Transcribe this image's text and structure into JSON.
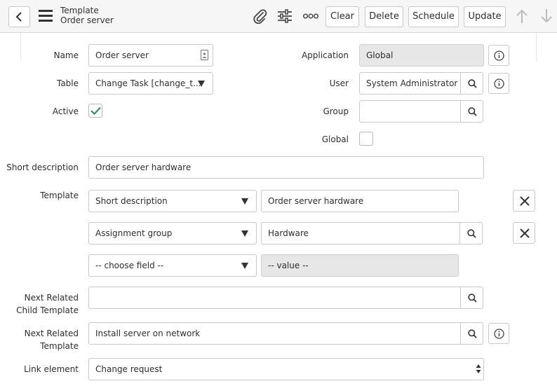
{
  "header": {
    "title": "Template",
    "subtitle": "Order server",
    "buttons": {
      "clear": "Clear",
      "delete": "Delete",
      "schedule": "Schedule",
      "update": "Update"
    },
    "icons": [
      "back-icon",
      "menu-icon",
      "paperclip-icon",
      "sliders-icon",
      "more-icon",
      "arrow-up-icon",
      "arrow-down-icon"
    ]
  },
  "form": {
    "name": {
      "label": "Name",
      "value": "Order server"
    },
    "table": {
      "label": "Table",
      "value": "Change Task [change_t..."
    },
    "active": {
      "label": "Active",
      "checked": true
    },
    "application": {
      "label": "Application",
      "value": "Global"
    },
    "user": {
      "label": "User",
      "value": "System Administrator"
    },
    "group": {
      "label": "Group",
      "value": ""
    },
    "global": {
      "label": "Global",
      "checked": false
    },
    "short_description": {
      "label": "Short description",
      "value": "Order server hardware"
    },
    "template": {
      "label": "Template",
      "rows": [
        {
          "field": "Short description",
          "value": "Order server hardware"
        },
        {
          "field": "Assignment group",
          "value": "Hardware"
        },
        {
          "field": "-- choose field --",
          "value": "-- value --"
        }
      ]
    },
    "next_related_child": {
      "label_line1": "Next Related",
      "label_line2": "Child Template",
      "value": ""
    },
    "next_related_template": {
      "label_line1": "Next Related",
      "label_line2": "Template",
      "value": "Install server on network"
    },
    "link_element": {
      "label": "Link element",
      "value": "Change request"
    }
  },
  "colors": {
    "header_bg": "#f6f6f6",
    "border": "#c9c9c9",
    "readonly_bg": "#e7e7e7",
    "check": "#2f8f6f"
  }
}
